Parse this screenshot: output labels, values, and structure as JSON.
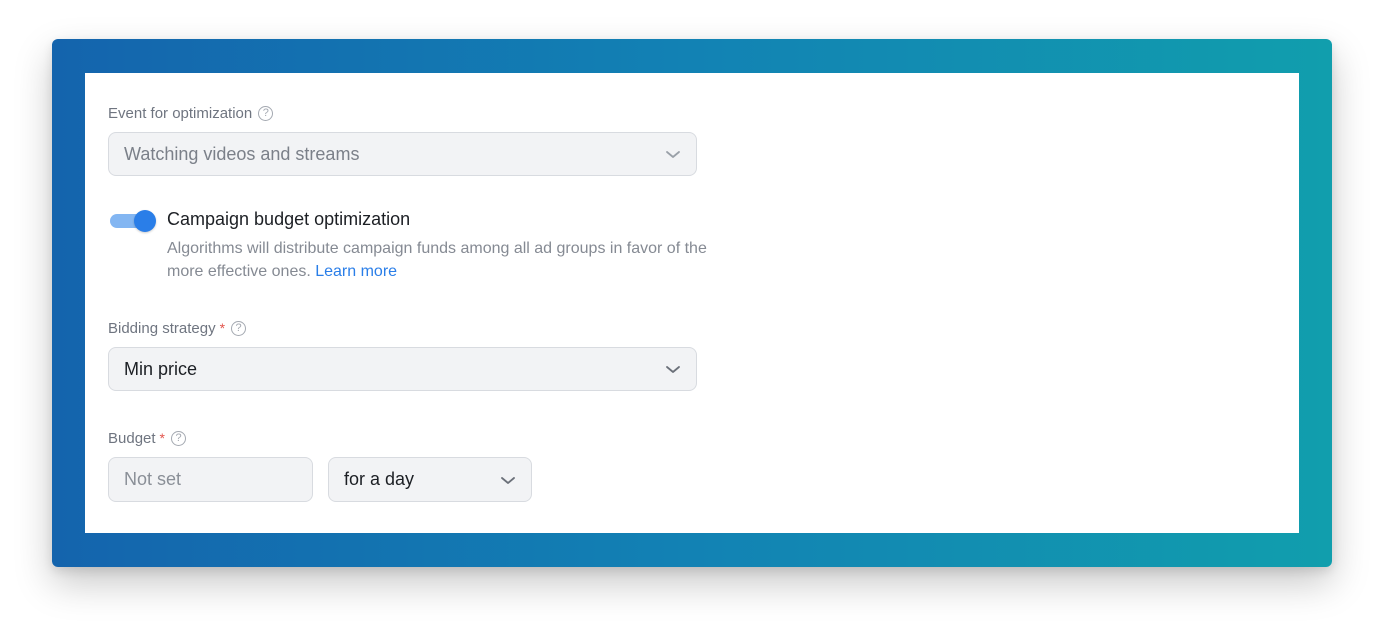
{
  "event_optimization": {
    "label": "Event for optimization",
    "help_glyph": "?",
    "value": "Watching videos and streams",
    "icon": "chevron-down-icon"
  },
  "budget_optimization": {
    "enabled": true,
    "title": "Campaign budget optimization",
    "description": "Algorithms will distribute campaign funds among all ad groups in favor of the more effective ones.",
    "learn_more": "Learn more"
  },
  "bidding_strategy": {
    "label": "Bidding strategy",
    "required_mark": "*",
    "help_glyph": "?",
    "value": "Min price"
  },
  "budget": {
    "label": "Budget",
    "required_mark": "*",
    "help_glyph": "?",
    "amount_placeholder": "Not set",
    "period_value": "for a day"
  },
  "colors": {
    "accent": "#2a7ee8",
    "required": "#e2544c",
    "frame_start": "#1464ad",
    "frame_end": "#119ead"
  }
}
